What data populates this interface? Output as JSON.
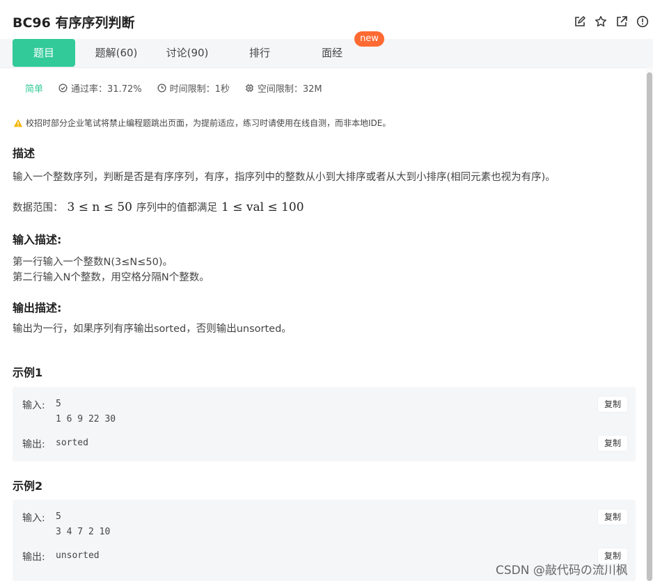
{
  "header": {
    "title": "BC96  有序序列判断"
  },
  "tabs": [
    {
      "label": "题目",
      "active": true
    },
    {
      "label": "题解(60)",
      "active": false
    },
    {
      "label": "讨论(90)",
      "active": false
    },
    {
      "label": "排行",
      "active": false
    },
    {
      "label": "面经",
      "active": false
    }
  ],
  "badge": "new",
  "meta": {
    "difficulty": "简单",
    "pass_rate": "通过率：31.72%",
    "time_limit": "时间限制：1秒",
    "memory_limit": "空间限制：32M"
  },
  "warning": "校招时部分企业笔试将禁止编程题跳出页面，为提前适应，练习时请使用在线自测，而非本地IDE。",
  "description": {
    "heading": "描述",
    "text": "输入一个整数序列，判断是否是有序序列，有序，指序列中的整数从小到大排序或者从大到小排序(相同元素也视为有序)。",
    "range_label": "数据范围：",
    "range_math1": "3 ≤ n ≤ 50",
    "range_mid": "序列中的值都满足",
    "range_math2": "1 ≤ val ≤ 100"
  },
  "input_desc": {
    "heading": "输入描述:",
    "line1": "第一行输入一个整数N(3≤N≤50)。",
    "line2": "第二行输入N个整数，用空格分隔N个整数。"
  },
  "output_desc": {
    "heading": "输出描述:",
    "line1": "输出为一行，如果序列有序输出sorted，否则输出unsorted。"
  },
  "examples": [
    {
      "heading": "示例1",
      "input_label": "输入:",
      "input_line1": "5",
      "input_line2": "1 6 9 22 30",
      "output_label": "输出:",
      "output_value": "sorted",
      "copy_label": "复制"
    },
    {
      "heading": "示例2",
      "input_label": "输入:",
      "input_line1": "5",
      "input_line2": "3 4 7 2 10",
      "output_label": "输出:",
      "output_value": "unsorted",
      "copy_label": "复制"
    }
  ],
  "watermark": "CSDN @敲代码の流川枫",
  "colors": {
    "accent": "#32ca99",
    "badge": "#ff6a32",
    "warning": "#f5b400"
  },
  "icons": {
    "edit": "edit-icon",
    "star": "star-icon",
    "share": "external-link-icon",
    "report": "alert-circle-icon"
  }
}
